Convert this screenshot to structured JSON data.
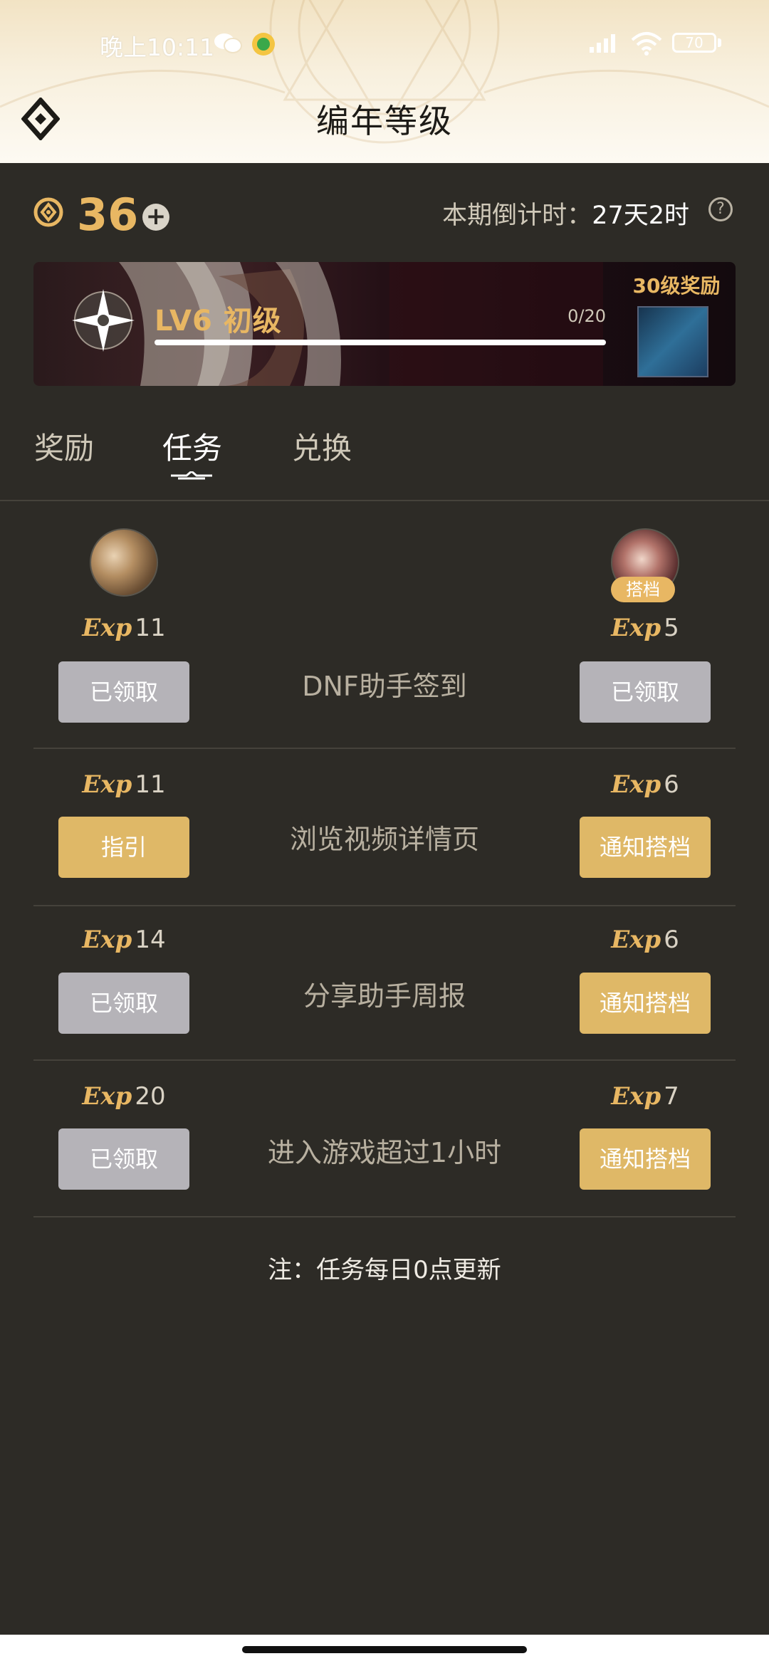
{
  "status_bar": {
    "time": "晚上10:11",
    "battery": "70"
  },
  "header": {
    "title": "编年等级"
  },
  "stats": {
    "coins": "36",
    "countdown_label": "本期倒计时：",
    "countdown_value": "27天2时",
    "help_symbol": "?"
  },
  "level": {
    "label": "LV6 初级",
    "progress_text": "0/20",
    "progress_fraction": 0.0,
    "reward_label": "30级奖励"
  },
  "tabs": [
    {
      "label": "奖励",
      "active": false
    },
    {
      "label": "任务",
      "active": true
    },
    {
      "label": "兑换",
      "active": false
    }
  ],
  "partner_badge": "搭档",
  "exp_prefix": "Exp",
  "tasks": [
    {
      "name": "DNF助手签到",
      "self_exp": "11",
      "self_button": "已领取",
      "partner_exp": "5",
      "partner_button": "已领取"
    },
    {
      "name": "浏览视频详情页",
      "self_exp": "11",
      "self_button": "指引",
      "partner_exp": "6",
      "partner_button": "通知搭档"
    },
    {
      "name": "分享助手周报",
      "self_exp": "14",
      "self_button": "已领取",
      "partner_exp": "6",
      "partner_button": "通知搭档"
    },
    {
      "name": "进入游戏超过1小时",
      "self_exp": "20",
      "self_button": "已领取",
      "partner_exp": "7",
      "partner_button": "通知搭档"
    }
  ],
  "note": "注：任务每日0点更新",
  "colors": {
    "accent_gold": "#e8b763",
    "button_gold": "#dfb867",
    "button_grey": "#b5b3b8",
    "background": "#2d2b26"
  }
}
